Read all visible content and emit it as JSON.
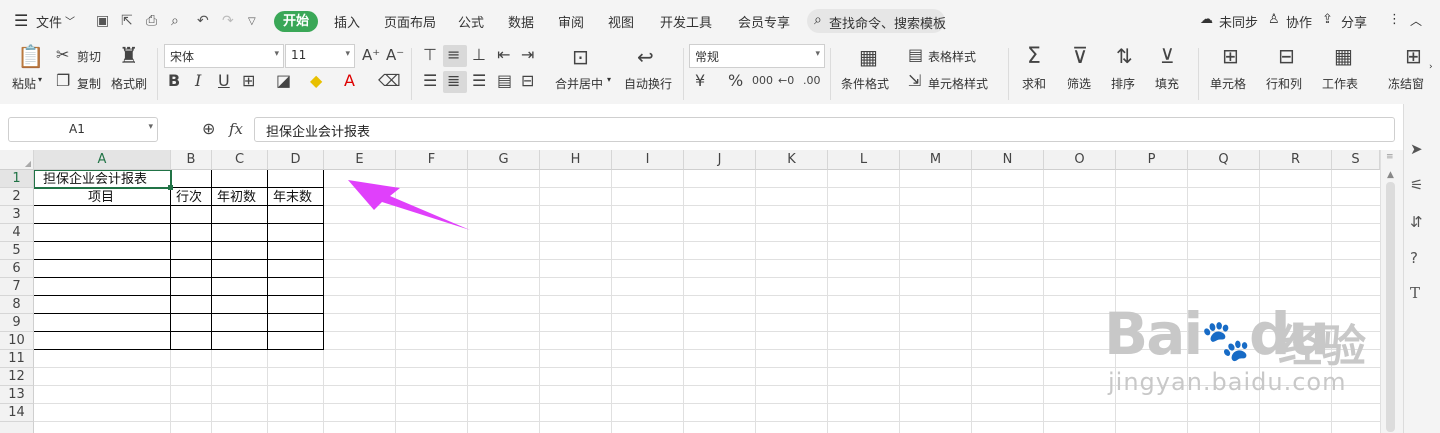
{
  "menubar": {
    "file_label": "文件",
    "tabs": [
      "开始",
      "插入",
      "页面布局",
      "公式",
      "数据",
      "审阅",
      "视图",
      "开发工具",
      "会员专享"
    ],
    "search_placeholder": "查找命令、搜索模板",
    "sync_label": "未同步",
    "collab_label": "协作",
    "share_label": "分享"
  },
  "ribbon": {
    "paste": "粘贴",
    "cut": "剪切",
    "copy": "复制",
    "format_painter": "格式刷",
    "font_name": "宋体",
    "font_size": "11",
    "merge_center": "合并居中",
    "auto_wrap": "自动换行",
    "number_format": "常规",
    "conditional_format": "条件格式",
    "table_style": "表格样式",
    "cell_style": "单元格样式",
    "sum": "求和",
    "filter": "筛选",
    "sort": "排序",
    "fill": "填充",
    "cell": "单元格",
    "row_col": "行和列",
    "worksheet": "工作表",
    "freeze": "冻结窗"
  },
  "formula_bar": {
    "name_box": "A1",
    "fx": "fx",
    "content": "担保企业会计报表"
  },
  "sheet": {
    "columns": [
      "A",
      "B",
      "C",
      "D",
      "E",
      "F",
      "G",
      "H",
      "I",
      "J",
      "K",
      "L",
      "M",
      "N",
      "O",
      "P",
      "Q",
      "R",
      "S"
    ],
    "rows": [
      "1",
      "2",
      "3",
      "4",
      "5",
      "6",
      "7",
      "8",
      "9",
      "10",
      "11",
      "12",
      "13",
      "14"
    ],
    "cells": {
      "A1": "担保企业会计报表",
      "A2": "项目",
      "B2": "行次",
      "C2": "年初数",
      "D2": "年末数"
    }
  },
  "annotation": {
    "arrow_color": "#e040fb"
  },
  "watermark": {
    "brand": "Bai",
    "brand_suffix": "du",
    "cn": "经验",
    "url": "jingyan.baidu.com"
  },
  "colors": {
    "accent": "#3aa757",
    "selection": "#217346"
  }
}
